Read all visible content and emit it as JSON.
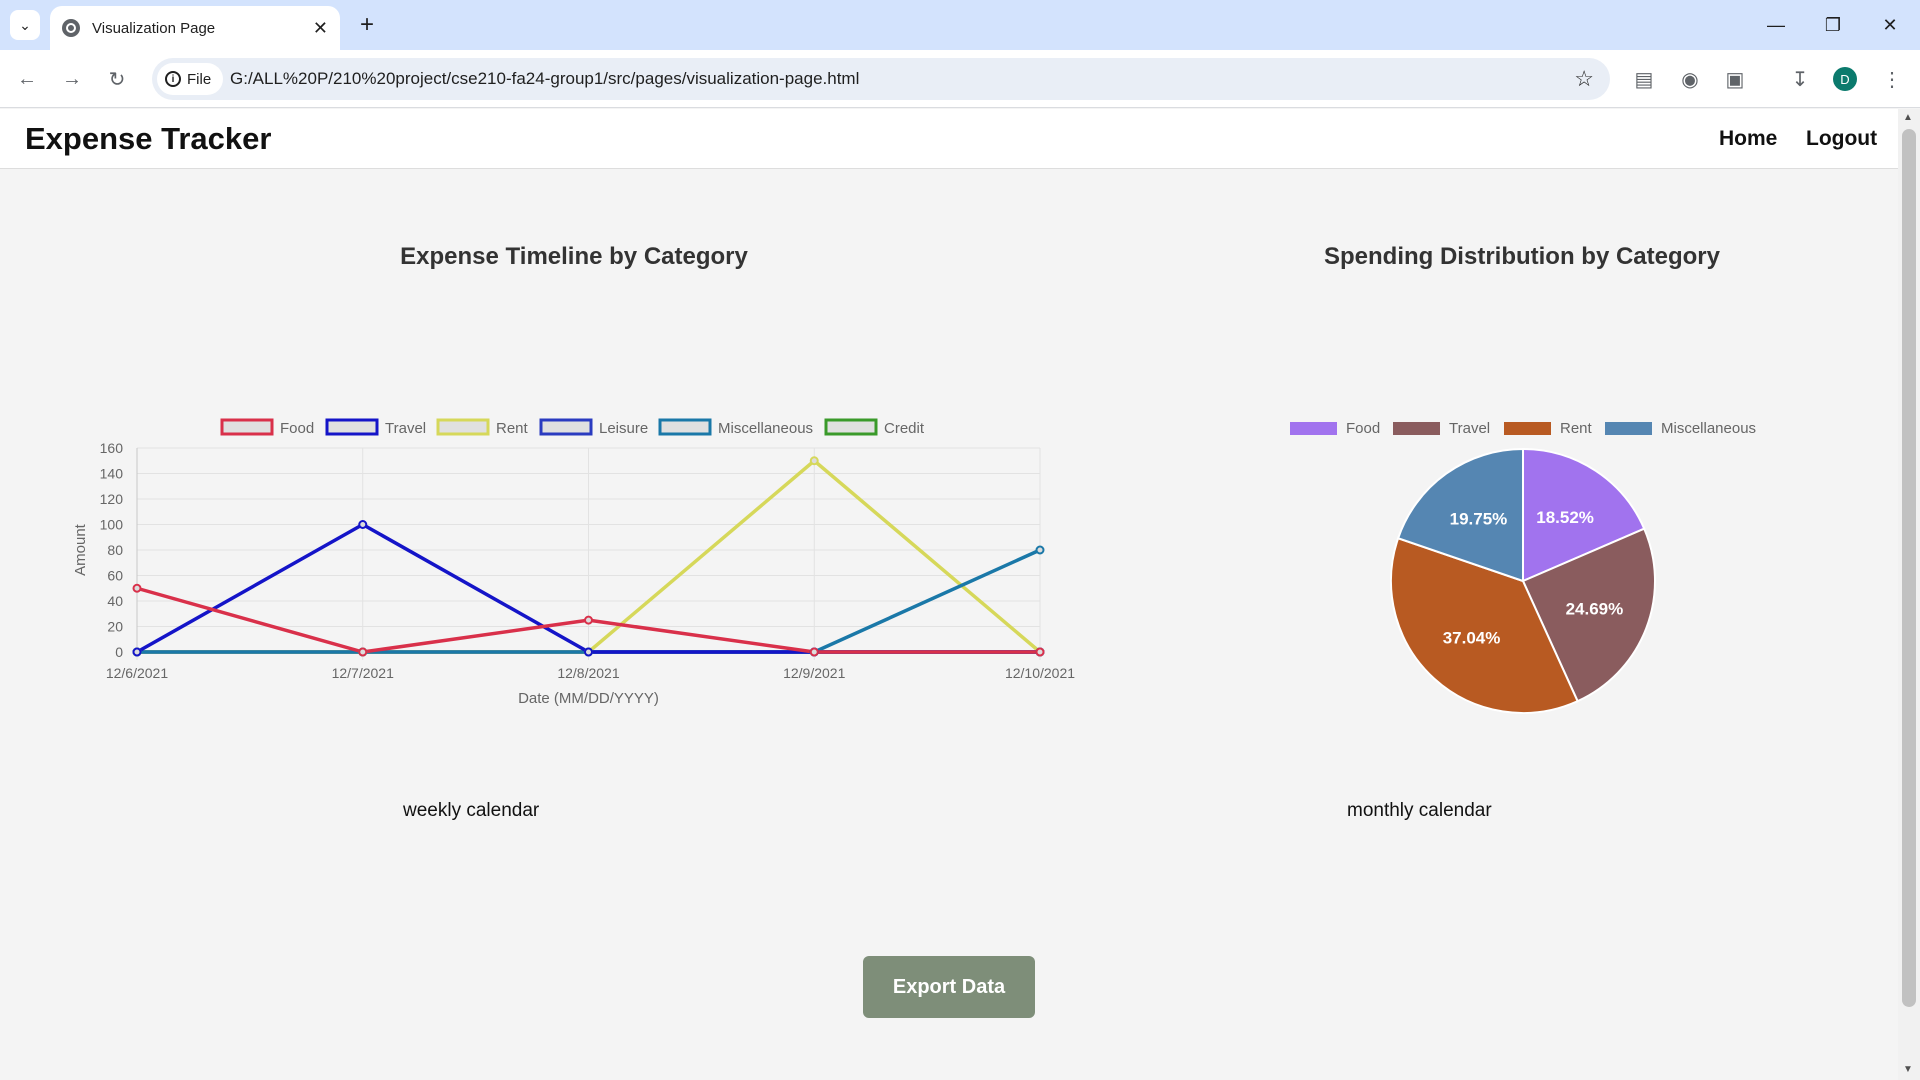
{
  "browser": {
    "tab_title": "Visualization Page",
    "site_chip": "File",
    "url": "G:/ALL%20P/210%20project/cse210-fa24-group1/src/pages/visualization-page.html",
    "avatar_letter": "D"
  },
  "header": {
    "title": "Expense Tracker",
    "nav": [
      "Home",
      "Logout"
    ]
  },
  "calendars": {
    "weekly": "weekly calendar",
    "monthly": "monthly calendar"
  },
  "export_label": "Export Data",
  "chart_data": [
    {
      "type": "line",
      "title": "Expense Timeline by Category",
      "xlabel": "Date (MM/DD/YYYY)",
      "ylabel": "Amount",
      "x": [
        "12/6/2021",
        "12/7/2021",
        "12/8/2021",
        "12/9/2021",
        "12/10/2021"
      ],
      "ylim": [
        0,
        160
      ],
      "yticks": [
        0,
        20,
        40,
        60,
        80,
        100,
        120,
        140,
        160
      ],
      "grid": true,
      "legend": "top",
      "series": [
        {
          "name": "Food",
          "color": "#d9304a",
          "values": [
            50,
            0,
            25,
            0,
            0
          ]
        },
        {
          "name": "Travel",
          "color": "#1414c8",
          "values": [
            0,
            100,
            0,
            0,
            0
          ]
        },
        {
          "name": "Rent",
          "color": "#d6d85a",
          "values": [
            0,
            0,
            0,
            150,
            0
          ]
        },
        {
          "name": "Leisure",
          "color": "#2a3bc0",
          "values": [
            0,
            0,
            0,
            0,
            0
          ]
        },
        {
          "name": "Miscellaneous",
          "color": "#1a78a8",
          "values": [
            0,
            0,
            0,
            0,
            80
          ]
        },
        {
          "name": "Credit",
          "color": "#3a9a2a",
          "values": [
            0,
            0,
            0,
            0,
            0
          ]
        }
      ]
    },
    {
      "type": "pie",
      "title": "Spending Distribution by Category",
      "legend": "top",
      "slices": [
        {
          "name": "Food",
          "value": 18.52,
          "label": "18.52%",
          "color": "#a173ee"
        },
        {
          "name": "Travel",
          "value": 24.69,
          "label": "24.69%",
          "color": "#8a5c5e"
        },
        {
          "name": "Rent",
          "value": 37.04,
          "label": "37.04%",
          "color": "#b85a22"
        },
        {
          "name": "Miscellaneous",
          "value": 19.75,
          "label": "19.75%",
          "color": "#5586b2"
        }
      ]
    }
  ]
}
